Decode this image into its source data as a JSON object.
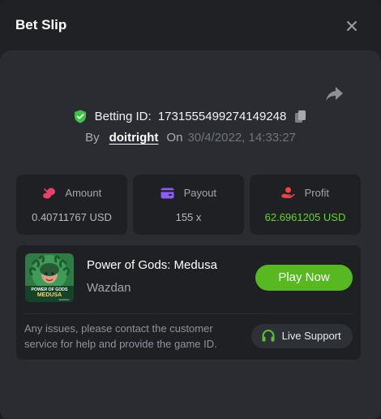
{
  "header": {
    "title": "Bet Slip"
  },
  "bet": {
    "id_label": "Betting ID:",
    "id_value": "1731555499274149248",
    "by_label": "By",
    "user": "doitright",
    "on_label": "On",
    "datetime": "30/4/2022, 14:33:27"
  },
  "stats": {
    "amount": {
      "label": "Amount",
      "value": "0.40711767 USD",
      "icon": "coins-icon"
    },
    "payout": {
      "label": "Payout",
      "value": "155 x",
      "icon": "wallet-icon"
    },
    "profit": {
      "label": "Profit",
      "value": "62.6961205 USD",
      "icon": "hand-coin-icon"
    }
  },
  "game": {
    "title": "Power of Gods: Medusa",
    "provider": "Wazdan",
    "thumb_logo_line1": "POWER OF GODS",
    "thumb_logo_line2": "MEDUSA",
    "thumb_logo_line3": "WAZDAN",
    "play_label": "Play Now",
    "issue_text": "Any issues, please contact the customer service for help and provide the game ID.",
    "support_label": "Live Support"
  },
  "colors": {
    "accent_green": "#57b822",
    "profit_green": "#6ad22f",
    "amount_icon": "#e9416a",
    "payout_icon": "#8b5cf6",
    "profit_icon": "#ef4444"
  }
}
